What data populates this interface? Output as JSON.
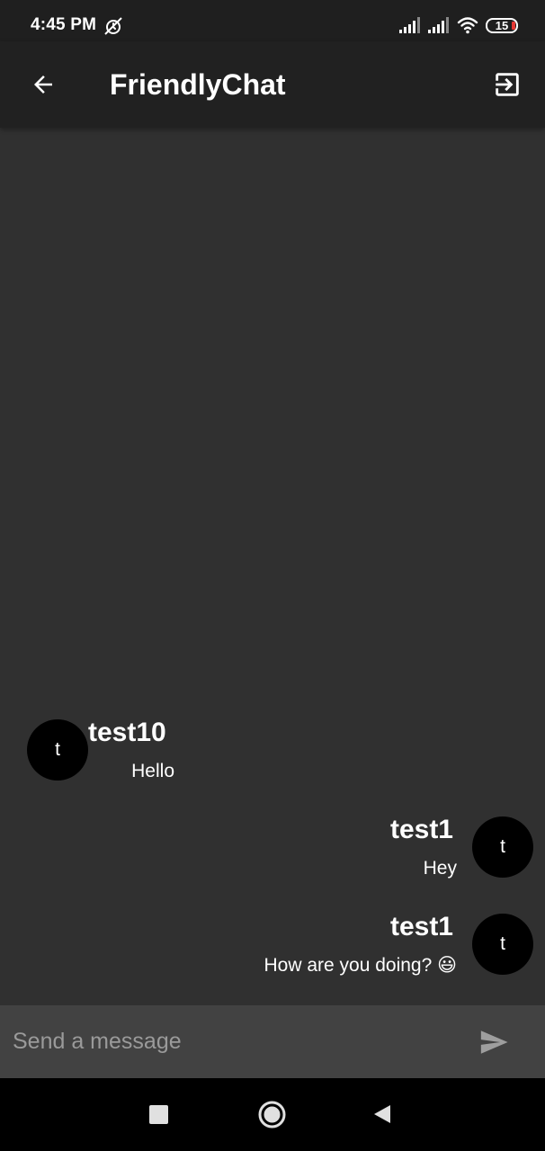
{
  "status_bar": {
    "time": "4:45 PM",
    "alarm_icon": "alarm-off-icon",
    "signal_icons": [
      "signal-icon",
      "signal-icon"
    ],
    "wifi_icon": "wifi-icon",
    "battery_level": "15"
  },
  "app_bar": {
    "title": "FriendlyChat",
    "back_icon": "arrow-back-icon",
    "logout_icon": "exit-icon"
  },
  "messages": [
    {
      "sender": "test10",
      "initial": "t",
      "text": "Hello",
      "side": "left"
    },
    {
      "sender": "test1",
      "initial": "t",
      "text": "Hey",
      "side": "right"
    },
    {
      "sender": "test1",
      "initial": "t",
      "text": "How are you doing? 😃",
      "side": "right"
    }
  ],
  "composer": {
    "placeholder": "Send a message",
    "value": "",
    "send_icon": "send-icon"
  },
  "nav_bar": {
    "icons": [
      "recents-icon",
      "home-icon",
      "back-icon"
    ]
  },
  "colors": {
    "background": "#303030",
    "app_bar": "#212121",
    "status_bar": "#1f1f1f",
    "composer": "#424242",
    "avatar": "#000000",
    "battery_low": "#e53935"
  }
}
